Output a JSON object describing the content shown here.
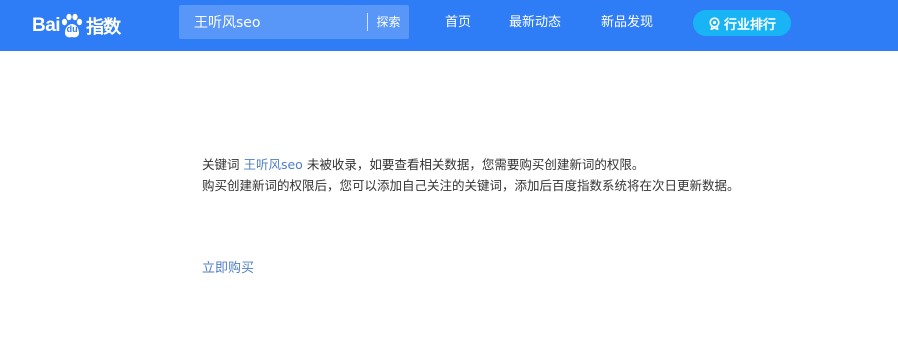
{
  "header": {
    "logo": {
      "text_bai": "Bai",
      "text_du": "du",
      "text_zhishu": "指数"
    },
    "search": {
      "value": "王听风seo",
      "button_label": "探索"
    },
    "nav": [
      {
        "label": "首页"
      },
      {
        "label": "最新动态"
      },
      {
        "label": "新品发现"
      }
    ],
    "ranking_button": {
      "label": "行业排行",
      "icon": "trophy-icon"
    }
  },
  "main": {
    "line1_prefix": "关键词 ",
    "keyword": "王听风seo",
    "line1_suffix": " 未被收录，如要查看相关数据，您需要购买创建新词的权限。",
    "line2": "购买创建新词的权限后，您可以添加自己关注的关键词，添加后百度指数系统将在次日更新数据。",
    "buy_link_label": "立即购买"
  },
  "colors": {
    "header_bg": "#2f7df6",
    "search_bg": "#5896f8",
    "ranking_bg": "#19b4f5",
    "link": "#4e7ec6",
    "text": "#333333"
  }
}
